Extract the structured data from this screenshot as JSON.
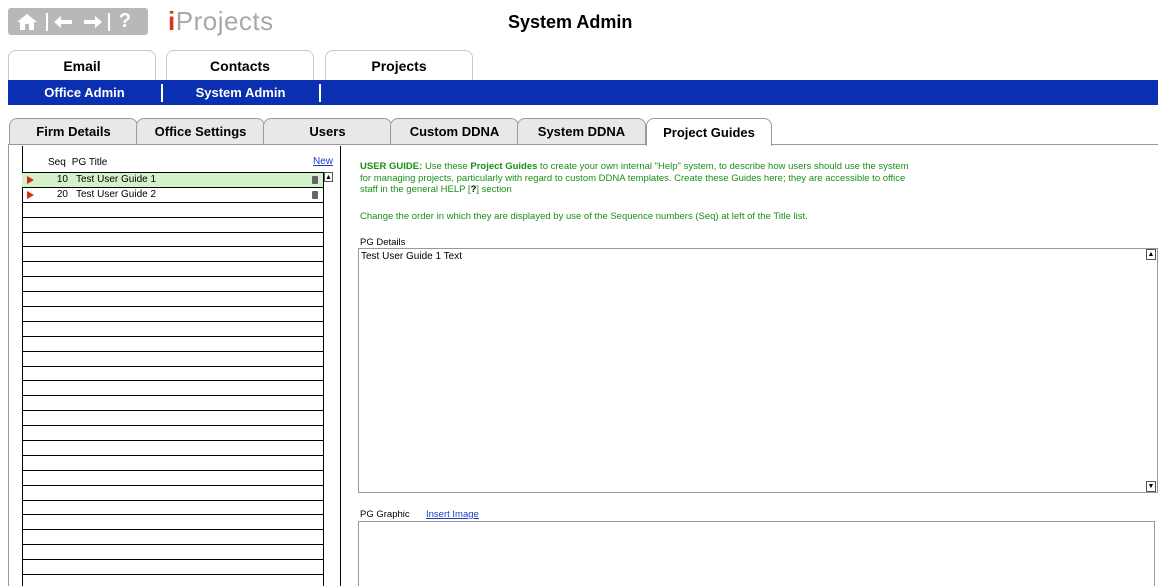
{
  "header": {
    "brand_prefix": "i",
    "brand_rest": "Projects",
    "title": "System Admin",
    "nav_icons": [
      "home-icon",
      "back-icon",
      "forward-icon",
      "help-icon"
    ],
    "help_glyph": "?"
  },
  "main_tabs": [
    {
      "label": "Email"
    },
    {
      "label": "Contacts"
    },
    {
      "label": "Projects"
    }
  ],
  "sub_nav": [
    {
      "label": "Office Admin"
    },
    {
      "label": "System Admin"
    }
  ],
  "section_tabs": [
    {
      "label": "Firm Details"
    },
    {
      "label": "Office Settings"
    },
    {
      "label": "Users"
    },
    {
      "label": "Custom DDNA"
    },
    {
      "label": "System DDNA"
    },
    {
      "label": "Project Guides",
      "active": true
    }
  ],
  "list": {
    "col_seq": "Seq",
    "col_title": "PG Title",
    "new_label": "New",
    "rows": [
      {
        "seq": "10",
        "title": "Test User Guide 1",
        "selected": true
      },
      {
        "seq": "20",
        "title": "Test User Guide 2",
        "selected": false
      }
    ]
  },
  "guide": {
    "label": "USER GUIDE:",
    "text_a": "Use these ",
    "bold": "Project Guides",
    "text_b": " to create your own internal \"Help\" system, to describe how users should use the system for managing projects, particularly with regard to custom DDNA templates. Create these Guides here; they are accessible to office staff in the general HELP [",
    "help_mark": "?",
    "text_c": "] section",
    "order": "Change the order in which they are displayed by use of the Sequence numbers (Seq) at left of the Title list."
  },
  "details": {
    "label": "PG Details",
    "value": "Test User Guide 1 Text"
  },
  "graphic": {
    "label": "PG Graphic",
    "insert_label": "Insert Image"
  },
  "colors": {
    "blue_bar": "#0a2fb0",
    "guide_green": "#1a8f18",
    "selected_row": "#d4f2c9",
    "arrow_red": "#d82a10",
    "link_blue": "#1a3ccc"
  }
}
